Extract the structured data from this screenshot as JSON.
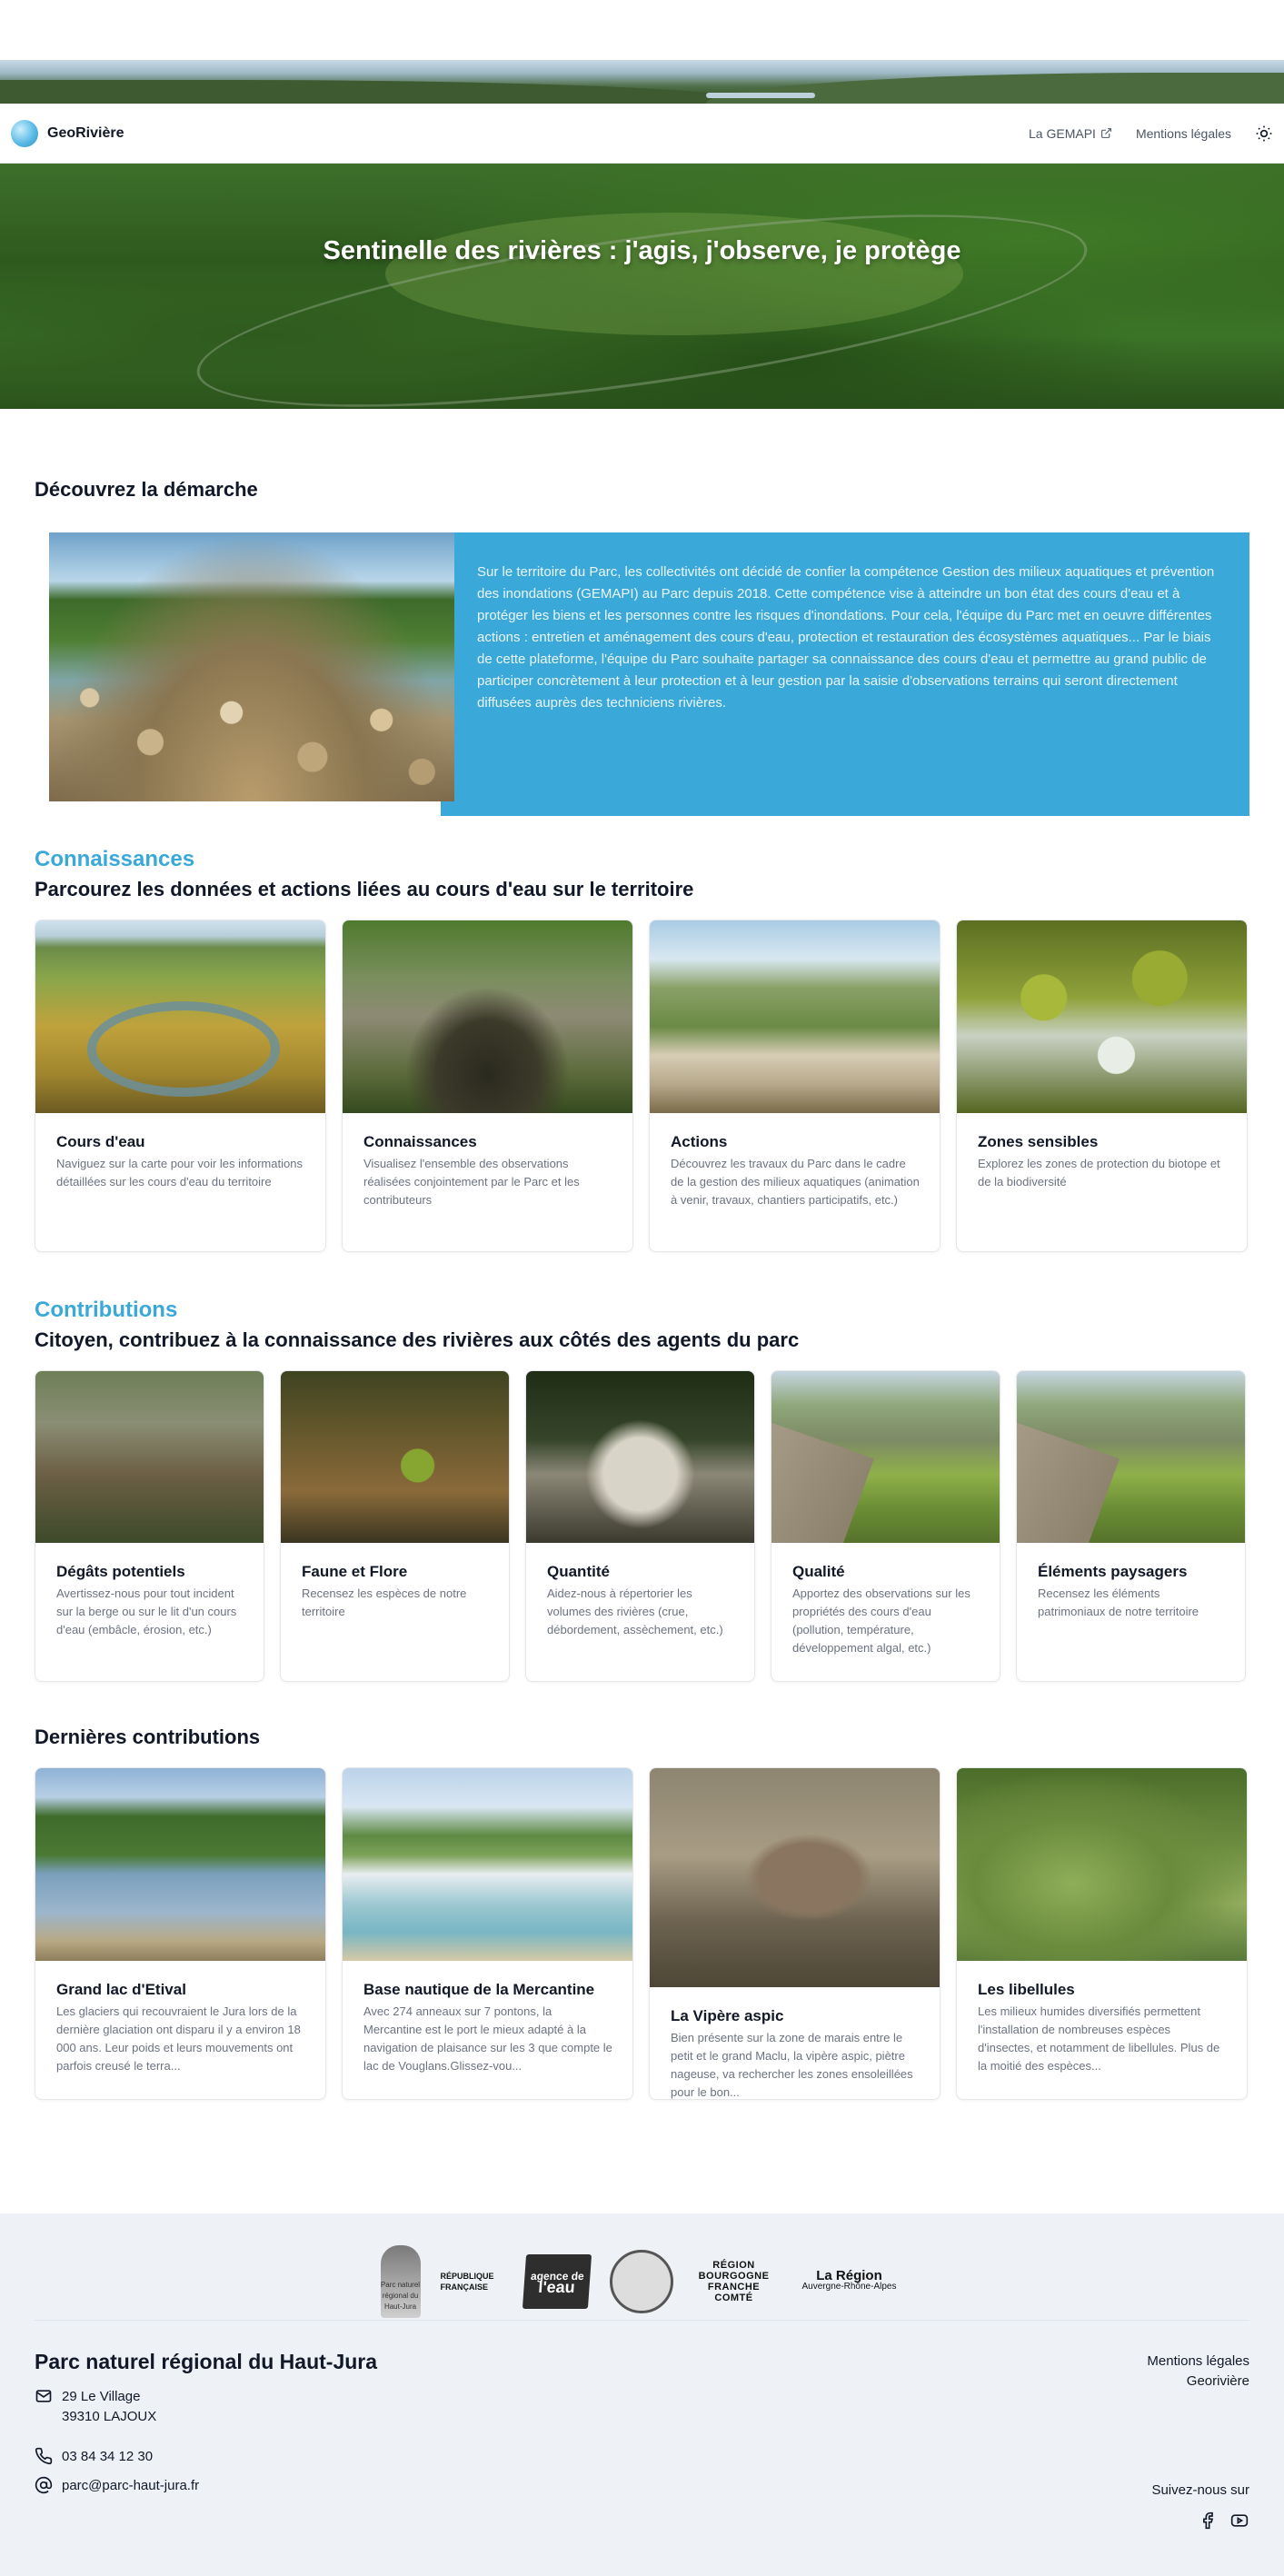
{
  "nav": {
    "brand": "GeoRivière",
    "links": [
      {
        "label": "La GEMAPI"
      },
      {
        "label": "Mentions légales"
      }
    ]
  },
  "hero": {
    "title": "Sentinelle des rivières : j'agis, j'observe, je protège"
  },
  "demarche": {
    "title": "Découvrez la démarche",
    "text": "Sur le territoire du Parc, les collectivités ont décidé de confier la compétence Gestion des milieux aquatiques et prévention des inondations (GEMAPI) au Parc depuis 2018. Cette compétence vise à atteindre un bon état des cours d'eau et à protéger les biens et les personnes contre les risques d'inondations. Pour cela, l'équipe du Parc met en oeuvre différentes actions : entretien et aménagement des cours d'eau, protection et restauration des écosystèmes aquatiques... Par le biais de cette plateforme, l'équipe du Parc souhaite partager sa connaissance des cours d'eau et permettre au grand public de participer concrètement à leur protection et à leur gestion par la saisie d'observations terrains qui seront directement diffusées auprès des techniciens rivières."
  },
  "connaissances": {
    "eyebrow": "Connaissances",
    "title": "Parcourez les données et actions liées au cours d'eau sur le territoire",
    "cards": [
      {
        "title": "Cours d'eau",
        "desc": "Naviguez sur la carte pour voir les informations détaillées sur les cours d'eau du territoire"
      },
      {
        "title": "Connaissances",
        "desc": "Visualisez l'ensemble des observations réalisées conjointement par le Parc et les contributeurs"
      },
      {
        "title": "Actions",
        "desc": "Découvrez les travaux du Parc dans le cadre de la gestion des milieux aquatiques (animation à venir, travaux, chantiers participatifs, etc.)"
      },
      {
        "title": "Zones sensibles",
        "desc": "Explorez les zones de protection du biotope et de la biodiversité"
      }
    ]
  },
  "contributions": {
    "eyebrow": "Contributions",
    "title": "Citoyen, contribuez à la connaissance des rivières aux côtés des agents du parc",
    "cards": [
      {
        "title": "Dégâts potentiels",
        "desc": "Avertissez-nous pour tout incident sur la berge ou sur le lit d'un cours d'eau (embâcle, érosion, etc.)"
      },
      {
        "title": "Faune et Flore",
        "desc": "Recensez les espèces de notre territoire"
      },
      {
        "title": "Quantité",
        "desc": "Aidez-nous à répertorier les volumes des rivières (crue, débordement, assèchement, etc.)"
      },
      {
        "title": "Qualité",
        "desc": "Apportez des observations sur les propriétés des cours d'eau (pollution, température, développement algal, etc.)"
      },
      {
        "title": "Éléments paysagers",
        "desc": "Recensez les éléments patrimoniaux de notre territoire"
      }
    ]
  },
  "dernieres": {
    "title": "Dernières contributions",
    "cards": [
      {
        "title": "Grand lac d'Etival",
        "desc": "Les glaciers qui recouvraient le Jura lors de la dernière glaciation ont disparu il y a environ 18 000 ans. Leur poids et leurs mouvements ont parfois creusé le terra..."
      },
      {
        "title": "Base nautique de la Mercantine",
        "desc": "Avec 274 anneaux sur 7 pontons, la Mercantine est le port le mieux adapté à la navigation de plaisance sur les 3 que compte le lac de Vouglans.Glissez-vou..."
      },
      {
        "title": "La Vipère aspic",
        "desc": "Bien présente sur la zone de marais entre le petit et le grand Maclu, la vipère aspic, piètre nageuse, va rechercher les zones ensoleillées pour le bon..."
      },
      {
        "title": "Les libellules",
        "desc": "Les milieux humides diversifiés permettent l'installation de nombreuses espèces d'insectes, et notamment de libellules. Plus de la moitié des espèces..."
      }
    ]
  },
  "footer": {
    "logos": {
      "parc": "Parc naturel régional du Haut-Jura",
      "republique": [
        "RÉPUBLIQUE",
        "FRANÇAISE"
      ],
      "agence": [
        "agence de",
        "l'eau"
      ],
      "bfc": [
        "RÉGION",
        "BOURGOGNE",
        "FRANCHE",
        "COMTÉ"
      ],
      "aura": [
        "La Région",
        "Auvergne-Rhône-Alpes"
      ]
    },
    "title": "Parc naturel régional du Haut-Jura",
    "address1": "29 Le Village",
    "address2": "39310 LAJOUX",
    "phone": "03 84 34 12 30",
    "email": "parc@parc-haut-jura.fr",
    "links": [
      "Mentions légales",
      "Georivière"
    ],
    "follow": "Suivez-nous sur"
  },
  "icons": [
    "external-link-icon",
    "sun-icon",
    "mail-icon",
    "phone-icon",
    "at-icon",
    "facebook-icon",
    "youtube-icon"
  ],
  "colors": {
    "accent": "#3aa8d8",
    "footer_bg": "#eef2f7"
  }
}
